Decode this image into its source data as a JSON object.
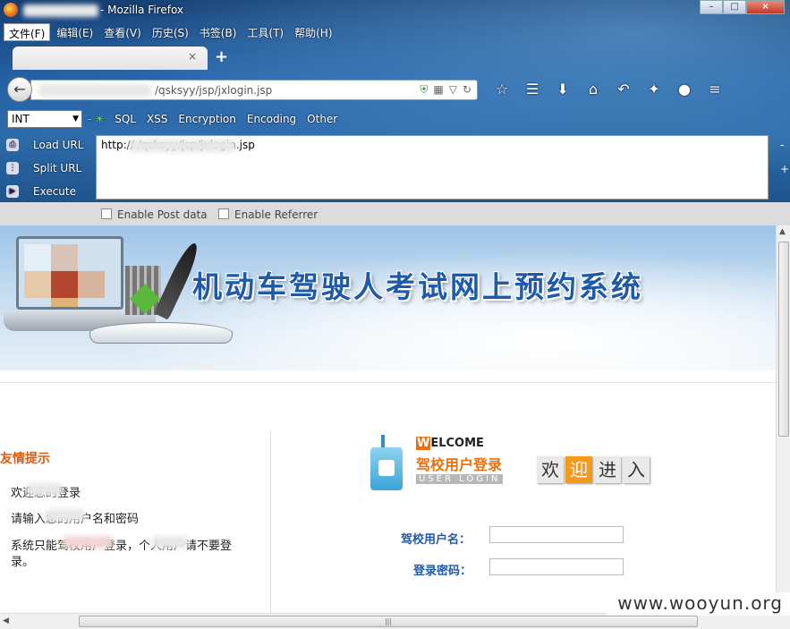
{
  "window": {
    "title": "- Mozilla Firefox"
  },
  "menubar": {
    "items": [
      "文件(F)",
      "编辑(E)",
      "查看(V)",
      "历史(S)",
      "书签(B)",
      "工具(T)",
      "帮助(H)"
    ]
  },
  "tab": {
    "close_glyph": "×",
    "new_tab_glyph": "+"
  },
  "urlbar": {
    "url": "/qsksyy/jsp/jxlogin.jsp"
  },
  "hackbar": {
    "select_value": "INT",
    "menu": [
      "SQL",
      "XSS",
      "Encryption",
      "Encoding",
      "Other"
    ],
    "actions": [
      "Load URL",
      "Split URL",
      "Execute"
    ],
    "url_text": "http://                        /qsksyy/jsp/jxlogin.jsp",
    "side_minus": "-",
    "side_plus": "+",
    "enable_post": "Enable Post data",
    "enable_referrer": "Enable Referrer"
  },
  "banner": {
    "title": "机动车驾驶人考试网上预约系统"
  },
  "tips": {
    "title": "友情提示",
    "line1": "欢迎您的登录",
    "line2": "请输入您的用户名和密码",
    "line3": "系统只能驾校用户登录，个人用户请不要登",
    "line3b": "录。"
  },
  "login": {
    "welcome_first": "W",
    "welcome_rest": "ELCOME",
    "school_login": "驾校用户登录",
    "user_login": "USER LOGIN",
    "huanying": [
      "欢",
      "迎",
      "进",
      "入"
    ],
    "username_label": "驾校用户名：",
    "password_label": "登录密码："
  },
  "watermark": "www.wooyun.org",
  "colors": {
    "accent_orange": "#e8710e",
    "title_blue": "#1e5aa8"
  }
}
